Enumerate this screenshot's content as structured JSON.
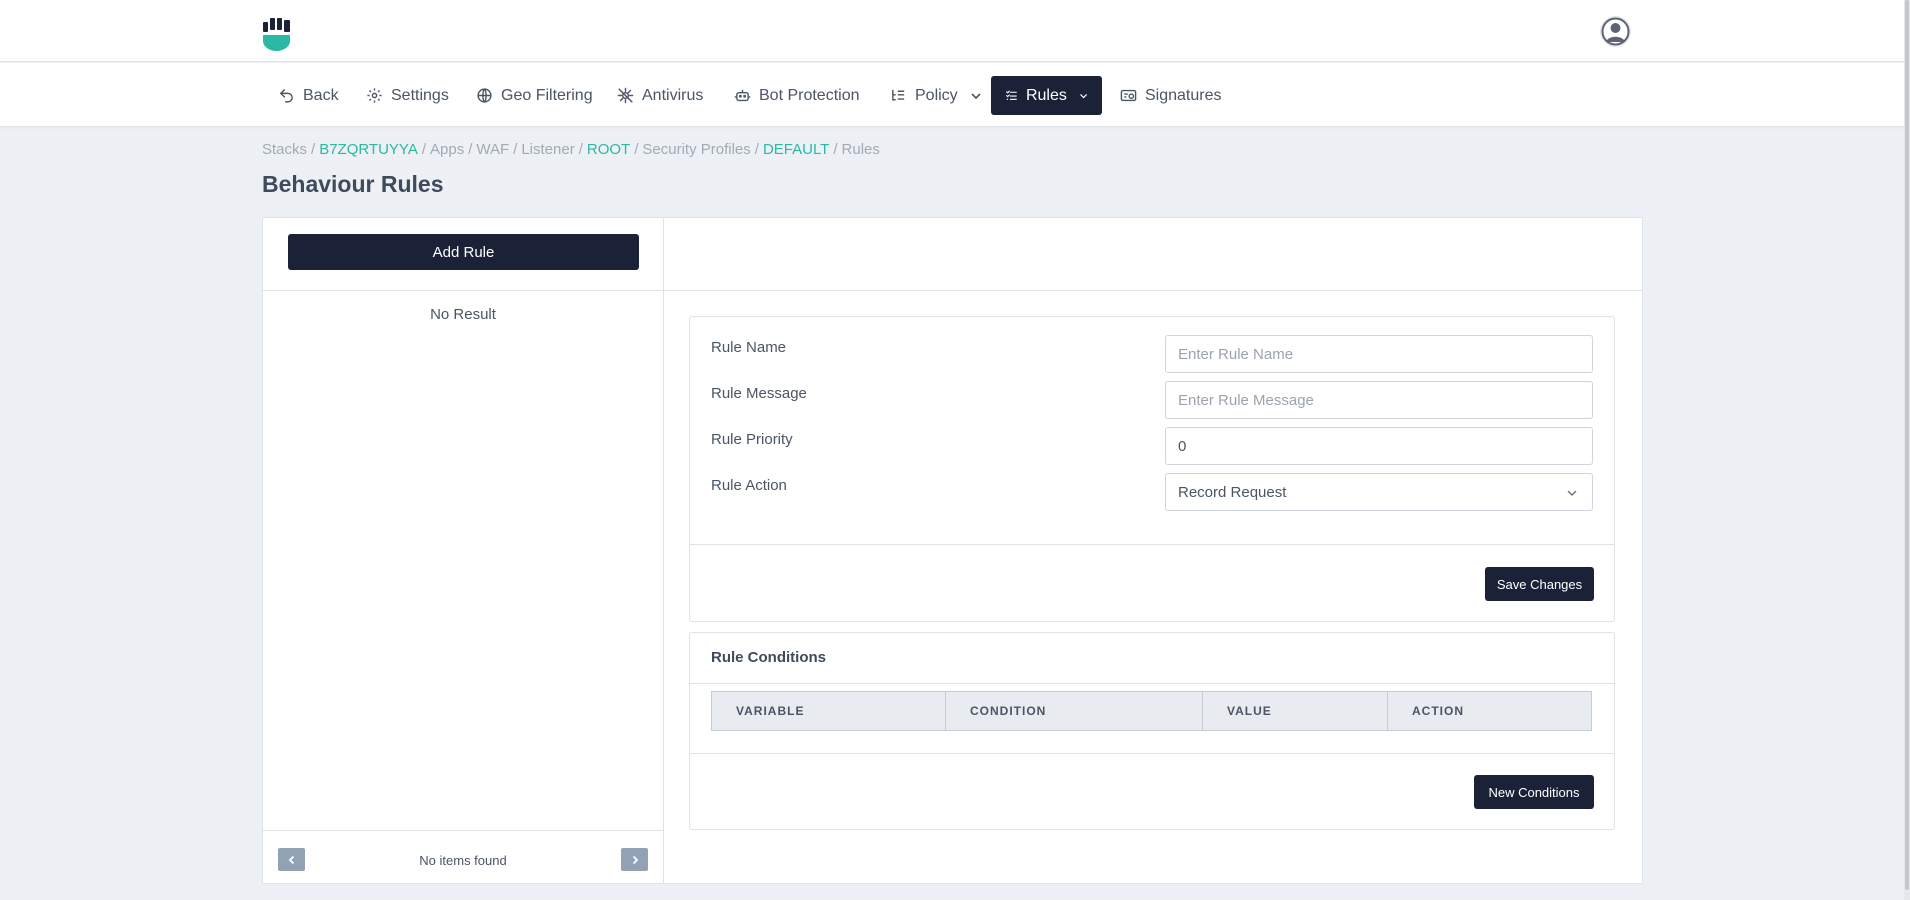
{
  "colors": {
    "brand_dark": "#1b2238",
    "accent_teal": "#2bb8a4",
    "page_bg": "#edf0f4"
  },
  "nav": {
    "items": [
      {
        "label": "Back",
        "icon": "undo-icon"
      },
      {
        "label": "Settings",
        "icon": "gear-icon"
      },
      {
        "label": "Geo Filtering",
        "icon": "globe-icon"
      },
      {
        "label": "Antivirus",
        "icon": "virus-off-icon"
      },
      {
        "label": "Bot Protection",
        "icon": "robot-icon"
      },
      {
        "label": "Policy",
        "icon": "list-tree-icon",
        "dropdown": true
      },
      {
        "label": "Rules",
        "icon": "list-check-icon",
        "dropdown": true,
        "active": true
      },
      {
        "label": "Signatures",
        "icon": "id-card-icon"
      }
    ]
  },
  "breadcrumb": {
    "items": [
      "Stacks",
      "B7ZQRTUYYA",
      "Apps",
      "WAF",
      "Listener",
      "ROOT",
      "Security Profiles",
      "DEFAULT",
      "Rules"
    ],
    "separator": "/"
  },
  "page": {
    "title": "Behaviour Rules"
  },
  "left_panel": {
    "add_rule_label": "Add Rule",
    "empty_text": "No Result",
    "footer_text": "No items found"
  },
  "form": {
    "rule_name_label": "Rule Name",
    "rule_name_placeholder": "Enter Rule Name",
    "rule_message_label": "Rule Message",
    "rule_message_placeholder": "Enter Rule Message",
    "rule_priority_label": "Rule Priority",
    "rule_priority_value": "0",
    "rule_action_label": "Rule Action",
    "rule_action_value": "Record Request",
    "save_label": "Save Changes"
  },
  "conditions": {
    "title": "Rule Conditions",
    "columns": [
      "VARIABLE",
      "CONDITION",
      "VALUE",
      "ACTION"
    ],
    "new_label": "New Conditions"
  }
}
